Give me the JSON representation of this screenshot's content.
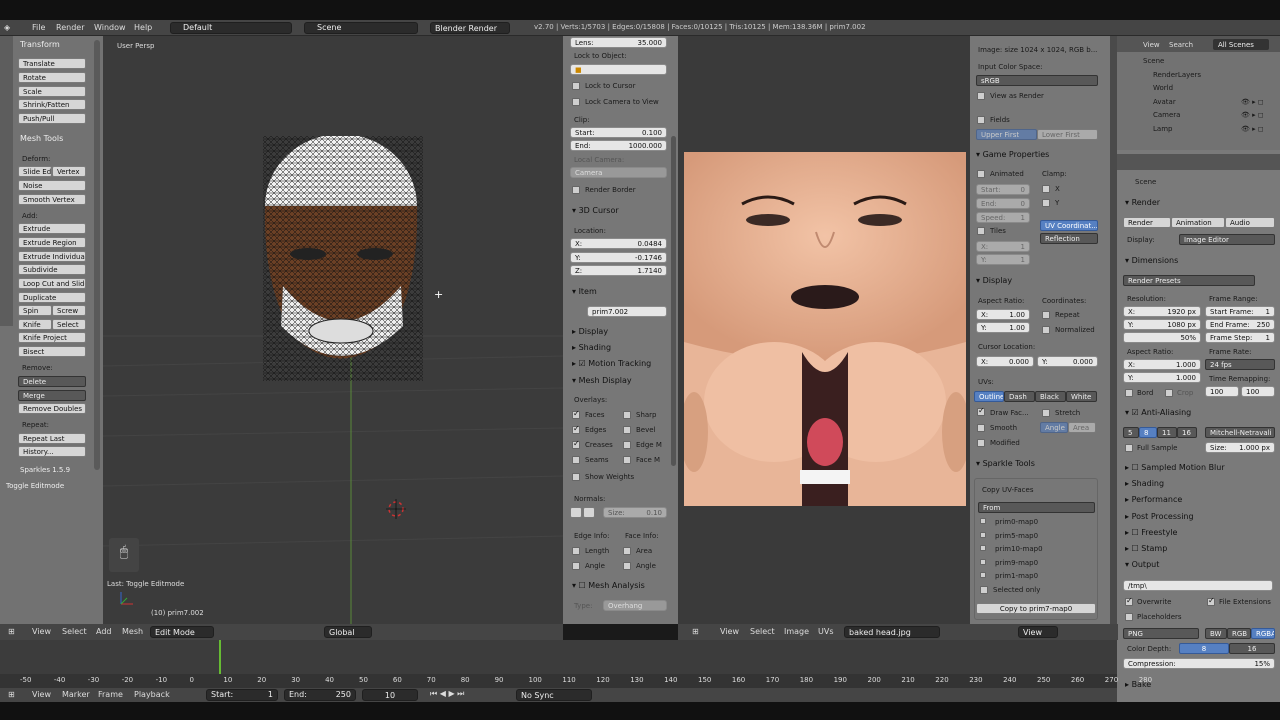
{
  "menu": {
    "file": "File",
    "render": "Render",
    "window": "Window",
    "help": "Help"
  },
  "header": {
    "layout": "Default",
    "scene": "Scene",
    "engine": "Blender Render",
    "stats": "v2.70 | Verts:1/5703 | Edges:0/15808 | Faces:0/10125 | Tris:10125 | Mem:138.36M | prim7.002"
  },
  "toolshelf": {
    "transform_title": "Transform",
    "translate": "Translate",
    "rotate": "Rotate",
    "scale": "Scale",
    "shrink": "Shrink/Fatten",
    "push": "Push/Pull",
    "mesh_tools_title": "Mesh Tools",
    "deform": "Deform:",
    "slide_edge": "Slide Ed",
    "vertex": "Vertex",
    "noise": "Noise",
    "smooth_vertex": "Smooth Vertex",
    "add": "Add:",
    "extrude": "Extrude",
    "extrude_region": "Extrude Region",
    "extrude_individual": "Extrude Individual",
    "subdivide": "Subdivide",
    "loop_cut": "Loop Cut and Slide",
    "duplicate": "Duplicate",
    "spin": "Spin",
    "screw": "Screw",
    "knife": "Knife",
    "select": "Select",
    "knife_project": "Knife Project",
    "bisect": "Bisect",
    "remove": "Remove:",
    "delete": "Delete",
    "merge": "Merge",
    "remove_doubles": "Remove Doubles",
    "repeat": "Repeat:",
    "repeat_last": "Repeat Last",
    "history": "History...",
    "sparkles": "Sparkles 1.5.9",
    "toggle_editmode": "Toggle Editmode",
    "tabs": [
      "Tools",
      "Create",
      "Relations",
      "Shading / UVs",
      "Options",
      "Grease Pencil",
      "Sparkles",
      "Avatar",
      "mmd_tools"
    ]
  },
  "viewport": {
    "label": "User Persp",
    "last_op": "Last: Toggle Editmode",
    "object": "(10) prim7.002"
  },
  "npanel": {
    "lens_label": "Lens:",
    "lens_value": "35.000",
    "lock_object": "Lock to Object:",
    "lock_cursor": "Lock to Cursor",
    "lock_camera": "Lock Camera to View",
    "clip": "Clip:",
    "start_label": "Start:",
    "start_value": "0.100",
    "end_label": "End:",
    "end_value": "1000.000",
    "local_camera": "Local Camera:",
    "camera": "Camera",
    "render_border": "Render Border",
    "cursor_title": "3D Cursor",
    "location": "Location:",
    "x_label": "X:",
    "x_value": "0.0484",
    "y_label": "Y:",
    "y_value": "-0.1746",
    "z_label": "Z:",
    "z_value": "1.7140",
    "item_title": "Item",
    "item_name": "prim7.002",
    "display": "Display",
    "shading": "Shading",
    "motion_tracking": "Motion Tracking",
    "mesh_display": "Mesh Display",
    "overlays": "Overlays:",
    "faces": "Faces",
    "sharp": "Sharp",
    "edges": "Edges",
    "bevel": "Bevel",
    "creases": "Creases",
    "edge_m": "Edge M",
    "seams": "Seams",
    "face_m": "Face M",
    "show_weights": "Show Weights",
    "normals": "Normals:",
    "size_label": "Size:",
    "size_value": "0.10",
    "edge_info": "Edge Info:",
    "face_info": "Face Info:",
    "length": "Length",
    "area": "Area",
    "angle": "Angle",
    "angle2": "Angle",
    "mesh_analysis": "Mesh Analysis",
    "type": "Type:",
    "overhang": "Overhang"
  },
  "uvtools": {
    "image_size": "Image: size 1024 x 1024, RGB b...",
    "input_color": "Input Color Space:",
    "srgb": "sRGB",
    "view_as_render": "View as Render",
    "fields": "Fields",
    "upper_first": "Upper First",
    "lower_first": "Lower First",
    "game_props": "Game Properties",
    "animated": "Animated",
    "clamp": "Clamp:",
    "start": "Start:",
    "start_v": "0",
    "end": "End:",
    "end_v": "0",
    "speed": "Speed:",
    "speed_v": "1",
    "x": "X",
    "y": "Y",
    "tiles": "Tiles",
    "uv_coord": "UV Coordinat...",
    "reflection": "Reflection",
    "tx": "X:",
    "tx_v": "1",
    "ty": "Y:",
    "ty_v": "1",
    "display": "Display",
    "aspect": "Aspect Ratio:",
    "coordinates": "Coordinates:",
    "ax": "X:",
    "ax_v": "1.00",
    "ay": "Y:",
    "ay_v": "1.00",
    "repeat": "Repeat",
    "normalized": "Normalized",
    "cursor_loc": "Cursor Location:",
    "cx": "X:",
    "cx_v": "0.000",
    "cy": "Y:",
    "cy_v": "0.000",
    "uvs": "UVs:",
    "outline": "Outline",
    "dash": "Dash",
    "black": "Black",
    "white": "White",
    "draw_faces": "Draw Fac...",
    "stretch": "Stretch",
    "smooth": "Smooth",
    "angle": "Angle",
    "area": "Area",
    "modified": "Modified",
    "sparkle_tools": "Sparkle Tools",
    "copy_uv": "Copy UV-Faces",
    "from": "From",
    "maps": [
      "prim0-map0",
      "prim5-map0",
      "prim10-map0",
      "prim9-map0",
      "prim1-map0"
    ],
    "selected_only": "Selected only",
    "copy_to": "Copy to prim7-map0"
  },
  "outliner": {
    "view": "View",
    "search": "Search",
    "all_scenes": "All Scenes",
    "items": [
      "Scene",
      "RenderLayers",
      "World",
      "Avatar",
      "Camera",
      "Lamp"
    ]
  },
  "props": {
    "scene": "Scene",
    "render": "Render",
    "render_tab": "Render",
    "animation_tab": "Animation",
    "audio_tab": "Audio",
    "display": "Display:",
    "image_editor": "Image Editor",
    "dimensions": "Dimensions",
    "render_presets": "Render Presets",
    "resolution": "Resolution:",
    "frame_range": "Frame Range:",
    "rx": "X:",
    "rx_v": "1920 px",
    "ry": "Y:",
    "ry_v": "1080 px",
    "pct": "50%",
    "start_frame": "Start Frame:",
    "start_frame_v": "1",
    "end_frame": "End Frame:",
    "end_frame_v": "250",
    "frame_step": "Frame Step:",
    "frame_step_v": "1",
    "aspect": "Aspect Ratio:",
    "frame_rate": "Frame Rate:",
    "asx": "X:",
    "asx_v": "1.000",
    "asy": "Y:",
    "asy_v": "1.000",
    "fps": "24 fps",
    "time_remap": "Time Remapping:",
    "border": "Bord",
    "crop": "Crop",
    "tr1": "100",
    "tr2": "100",
    "anti_alias": "Anti-Aliasing",
    "aa5": "5",
    "aa8": "8",
    "aa11": "11",
    "aa16": "16",
    "filter": "Mitchell-Netravali",
    "full_sample": "Full Sample",
    "size": "Size:",
    "size_v": "1.000 px",
    "motion_blur": "Sampled Motion Blur",
    "shading": "Shading",
    "performance": "Performance",
    "post_processing": "Post Processing",
    "freestyle": "Freestyle",
    "stamp": "Stamp",
    "output": "Output",
    "path": "/tmp\\",
    "overwrite": "Overwrite",
    "file_ext": "File Extensions",
    "placeholders": "Placeholders",
    "png": "PNG",
    "bw": "BW",
    "rgb": "RGB",
    "rgba": "RGBA",
    "color_depth": "Color Depth:",
    "depth8": "8",
    "depth16": "16",
    "compression": "Compression:",
    "compression_v": "15%",
    "bake": "Bake"
  },
  "vpheader": {
    "view": "View",
    "select": "Select",
    "add": "Add",
    "mesh": "Mesh",
    "mode": "Edit Mode",
    "orient": "Global"
  },
  "uvheader": {
    "view": "View",
    "select": "Select",
    "image": "Image",
    "uvs": "UVs",
    "image_name": "baked head.jpg",
    "view2": "View"
  },
  "timeline": {
    "ticks": [
      "-50",
      "-40",
      "-30",
      "-20",
      "-10",
      "0",
      "10",
      "20",
      "30",
      "40",
      "50",
      "60",
      "70",
      "80",
      "90",
      "100",
      "110",
      "120",
      "130",
      "140",
      "150",
      "160",
      "170",
      "180",
      "190",
      "200",
      "210",
      "220",
      "230",
      "240",
      "250",
      "260",
      "270",
      "280"
    ],
    "view": "View",
    "marker": "Marker",
    "frame": "Frame",
    "playback": "Playback",
    "start": "Start:",
    "start_v": "1",
    "end": "End:",
    "end_v": "250",
    "current": "10",
    "sync": "No Sync"
  }
}
